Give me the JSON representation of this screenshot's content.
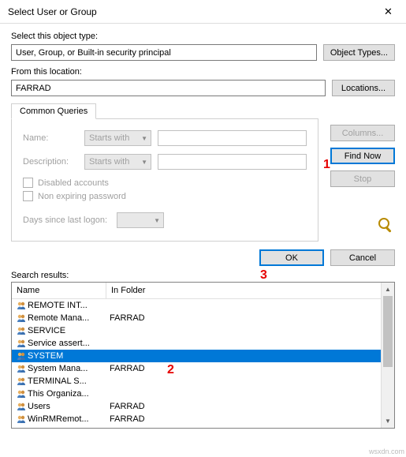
{
  "window": {
    "title": "Select User or Group",
    "close_glyph": "✕"
  },
  "object_type": {
    "label": "Select this object type:",
    "value": "User, Group, or Built-in security principal",
    "button": "Object Types..."
  },
  "location": {
    "label": "From this location:",
    "value": "FARRAD",
    "button": "Locations..."
  },
  "queries": {
    "tab_label": "Common Queries",
    "name_label": "Name:",
    "desc_label": "Description:",
    "starts_with": "Starts with",
    "disabled_accounts": "Disabled accounts",
    "non_expiring_pw": "Non expiring password",
    "days_since_logon": "Days since last logon:"
  },
  "side": {
    "columns": "Columns...",
    "find_now": "Find Now",
    "stop": "Stop"
  },
  "actions": {
    "ok": "OK",
    "cancel": "Cancel"
  },
  "results": {
    "label": "Search results:",
    "col_name": "Name",
    "col_folder": "In Folder",
    "items": [
      {
        "name": "REMOTE INT...",
        "folder": ""
      },
      {
        "name": "Remote Mana...",
        "folder": "FARRAD"
      },
      {
        "name": "SERVICE",
        "folder": ""
      },
      {
        "name": "Service assert...",
        "folder": ""
      },
      {
        "name": "SYSTEM",
        "folder": "",
        "selected": true
      },
      {
        "name": "System Mana...",
        "folder": "FARRAD"
      },
      {
        "name": "TERMINAL S...",
        "folder": ""
      },
      {
        "name": "This Organiza...",
        "folder": ""
      },
      {
        "name": "Users",
        "folder": "FARRAD"
      },
      {
        "name": "WinRMRemot...",
        "folder": "FARRAD"
      }
    ]
  },
  "annotations": {
    "one": "1",
    "two": "2",
    "three": "3"
  },
  "watermark": "wsxdn.com"
}
